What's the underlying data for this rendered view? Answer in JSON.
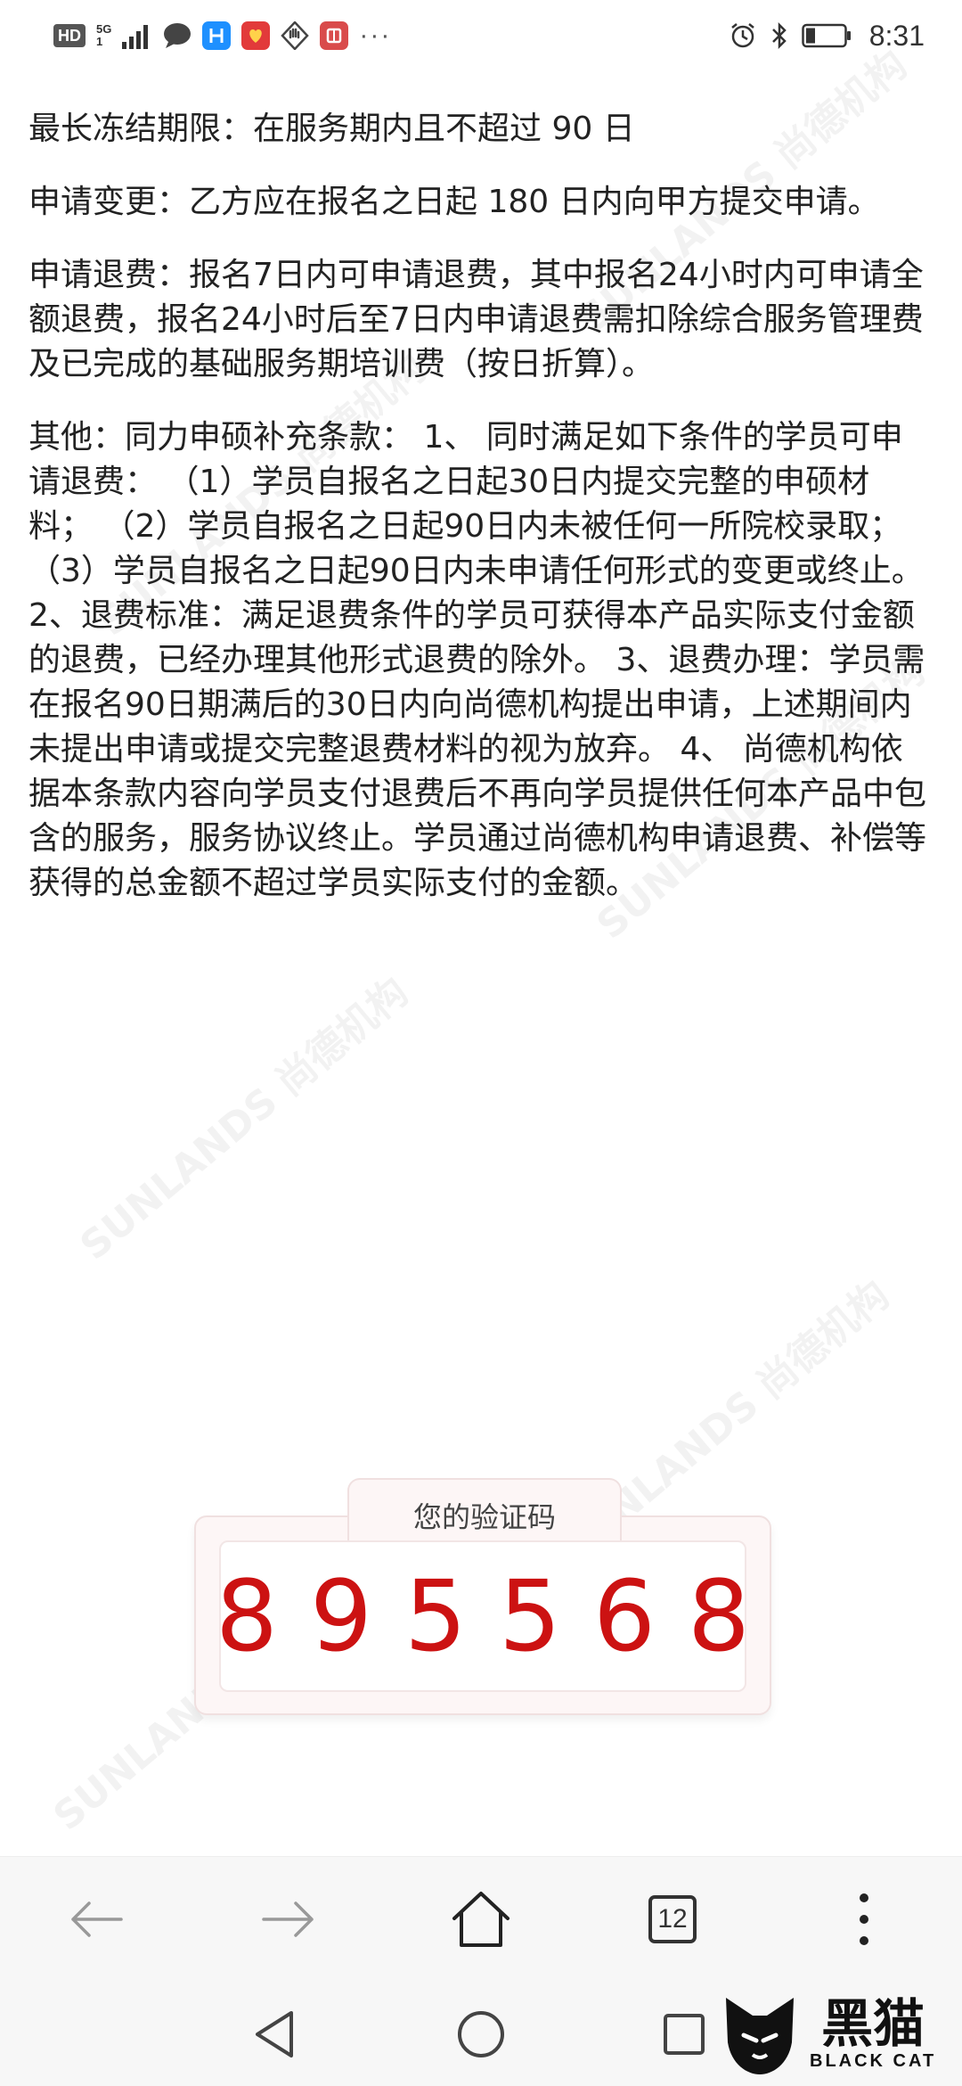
{
  "status_bar": {
    "hd_label": "HD",
    "network_label": "5G",
    "network_sub": "1",
    "time": "8:31",
    "notif_icons": [
      "chat-bubble-icon",
      "h-app-icon",
      "red-app-icon",
      "hand-icon",
      "book-icon"
    ],
    "more": "···"
  },
  "content": {
    "paragraphs": [
      "最长冻结期限：在服务期内且不超过 90 日",
      "申请变更：乙方应在报名之日起 180 日内向甲方提交申请。",
      "申请退费：报名7日内可申请退费，其中报名24小时内可申请全额退费，报名24小时后至7日内申请退费需扣除综合服务管理费及已完成的基础服务期培训费（按日折算）。",
      "其他：同力申硕补充条款： 1、 同时满足如下条件的学员可申请退费： （1）学员自报名之日起30日内提交完整的申硕材料； （2）学员自报名之日起90日内未被任何一所院校录取； （3）学员自报名之日起90日内未申请任何形式的变更或终止。 2、退费标准：满足退费条件的学员可获得本产品实际支付金额的退费，已经办理其他形式退费的除外。 3、退费办理：学员需在报名90日期满后的30日内向尚德机构提出申请，上述期间内未提出申请或提交完整退费材料的视为放弃。 4、 尚德机构依据本条款内容向学员支付退费后不再向学员提供任何本产品中包含的服务，服务协议终止。学员通过尚德机构申请退费、补偿等获得的总金额不超过学员实际支付的金额。"
    ]
  },
  "watermark": {
    "cn": "尚德机构",
    "en": "SUNLANDS"
  },
  "verification": {
    "label": "您的验证码",
    "code": "895568"
  },
  "browser_toolbar": {
    "tab_count": "12"
  },
  "logo": {
    "cn": "黑猫",
    "en": "BLACK CAT"
  },
  "colors": {
    "code_red": "#cc1212",
    "card_bg": "#fdf6f6"
  }
}
